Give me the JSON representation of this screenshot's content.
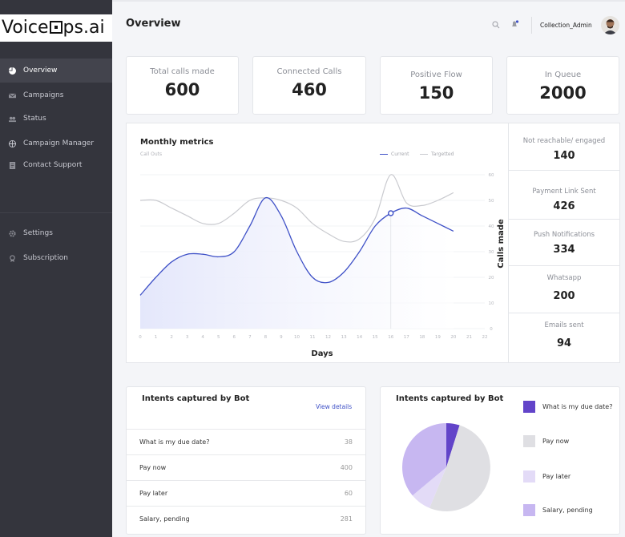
{
  "brand": {
    "pre": "Voice",
    "post": "ps.ai"
  },
  "sidebar": {
    "items": [
      {
        "label": "Overview",
        "icon": "pie-icon"
      },
      {
        "label": "Campaigns",
        "icon": "mail-icon"
      },
      {
        "label": "Status",
        "icon": "users-icon"
      },
      {
        "label": "Campaign Manager",
        "icon": "globe-icon"
      },
      {
        "label": "Contact Support",
        "icon": "document-icon"
      },
      {
        "label": "Settings",
        "icon": "gear-icon"
      },
      {
        "label": "Subscription",
        "icon": "badge-icon"
      }
    ]
  },
  "header": {
    "title": "Overview",
    "username": "Collection_Admin"
  },
  "stats": [
    {
      "label": "Total calls made",
      "value": "600"
    },
    {
      "label": "Connected Calls",
      "value": "460"
    },
    {
      "label": "Positive Flow",
      "value": "150"
    },
    {
      "label": "In Queue",
      "value": "2000"
    }
  ],
  "side_stats": [
    {
      "label": "Not reachable/ engaged",
      "value": "140"
    },
    {
      "label": "Payment Link Sent",
      "value": "426"
    },
    {
      "label": "Push Notifications",
      "value": "334"
    },
    {
      "label": "Whatsapp",
      "value": "200"
    },
    {
      "label": "Emails sent",
      "value": "94"
    }
  ],
  "intents": {
    "title": "Intents captured by Bot",
    "view_details": "View details",
    "rows": [
      {
        "label": "What is my due date?",
        "value": "38"
      },
      {
        "label": "Pay now",
        "value": "400"
      },
      {
        "label": "Pay later",
        "value": "60"
      },
      {
        "label": "Salary, pending",
        "value": "281"
      }
    ]
  },
  "colors": {
    "accent": "#3f51c7",
    "sidebar": "#34353d",
    "pie_dark": "#6244c9",
    "pie_grey": "#dfdfe3",
    "pie_light": "#e3dbf7",
    "pie_mid": "#c7b7f1"
  },
  "chart_data": [
    {
      "type": "line",
      "title": "Monthly metrics",
      "subtitle": "Call Outs",
      "xlabel": "Days",
      "ylabel": "Calls made",
      "x": [
        0,
        1,
        2,
        3,
        4,
        5,
        6,
        7,
        8,
        9,
        10,
        11,
        12,
        13,
        14,
        15,
        16,
        17,
        18,
        19,
        20,
        21,
        22
      ],
      "xlim": [
        0,
        22
      ],
      "ylim": [
        0,
        60
      ],
      "yticks": [
        0,
        10,
        20,
        30,
        40,
        50,
        60
      ],
      "legend": "top-right",
      "grid": true,
      "series": [
        {
          "name": "Current",
          "color": "#3f51c7",
          "x": [
            0,
            1,
            2,
            3,
            4,
            5,
            6,
            7,
            8,
            9,
            10,
            11,
            12,
            13,
            14,
            15,
            16,
            17,
            18,
            19,
            20
          ],
          "values": [
            13,
            20,
            26,
            29,
            29,
            28,
            30,
            40,
            51,
            44,
            30,
            20,
            18,
            22,
            30,
            40,
            45,
            47,
            44,
            41,
            38
          ],
          "marker_index": 16
        },
        {
          "name": "Targetted",
          "color": "#c9cacf",
          "x": [
            0,
            1,
            2,
            3,
            4,
            5,
            6,
            7,
            8,
            9,
            10,
            11,
            12,
            13,
            14,
            15,
            16,
            17,
            18,
            19,
            20
          ],
          "values": [
            50,
            50,
            47,
            44,
            41,
            41,
            45,
            50,
            51,
            50,
            47,
            41,
            37,
            34,
            35,
            43,
            60,
            49,
            48,
            50,
            53
          ]
        }
      ]
    },
    {
      "type": "pie",
      "title": "Intents captured by Bot",
      "legend": "right",
      "slices": [
        {
          "label": "What is my due date?",
          "value": 38,
          "color": "#6244c9"
        },
        {
          "label": "Pay now",
          "value": 400,
          "color": "#dfdfe3"
        },
        {
          "label": "Pay later",
          "value": 60,
          "color": "#e3dbf7"
        },
        {
          "label": "Salary, pending",
          "value": 281,
          "color": "#c7b7f1"
        }
      ]
    }
  ]
}
